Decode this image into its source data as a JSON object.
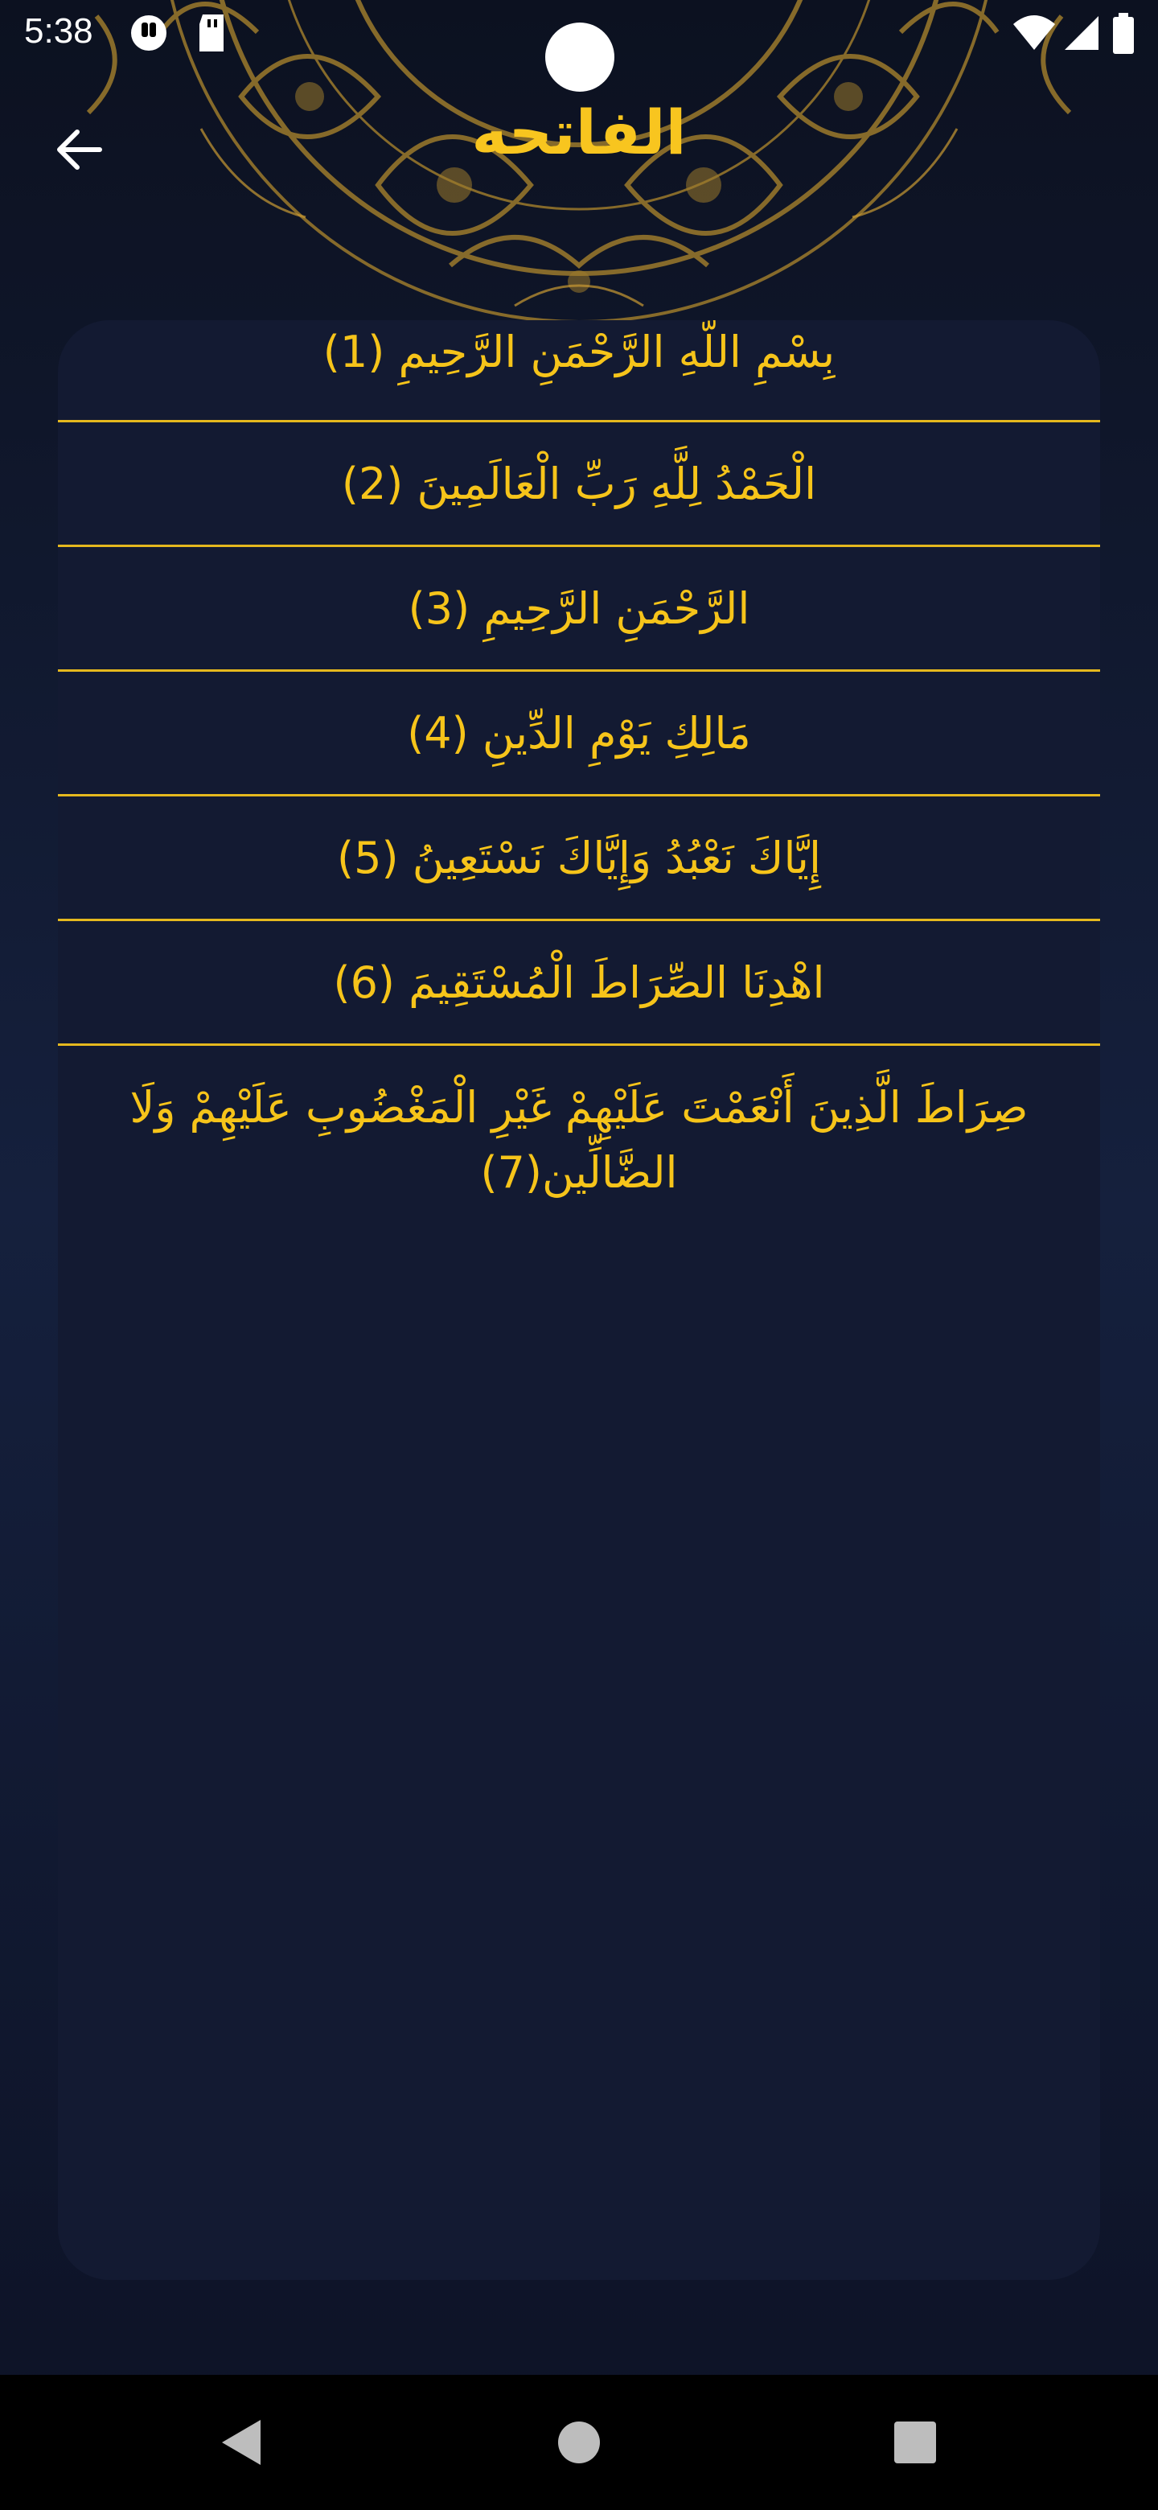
{
  "status_bar": {
    "time": "5:38",
    "icons": [
      "notification-icon",
      "sd-card-icon",
      "wifi-icon",
      "signal-icon",
      "battery-icon"
    ]
  },
  "app_bar": {
    "title": "الفاتحه",
    "back_icon": "arrow-left-icon"
  },
  "ayahs": [
    {
      "text": "بِسْمِ اللَّهِ الرَّحْمَنِ الرَّحِيمِ  (1)"
    },
    {
      "text": "الْحَمْدُ لِلَّهِ رَبِّ الْعَالَمِينَ (2)"
    },
    {
      "text": "الرَّحْمَنِ الرَّحِيمِ (3)"
    },
    {
      "text": "مَالِكِ يَوْمِ الدِّينِ (4)"
    },
    {
      "text": "إِيَّاكَ نَعْبُدُ وَإِيَّاكَ نَسْتَعِينُ (5)"
    },
    {
      "text": "اهْدِنَا الصِّرَاطَ الْمُسْتَقِيمَ (6)"
    },
    {
      "text": "صِرَاطَ الَّذِينَ أَنْعَمْتَ عَلَيْهِمْ غَيْرِ الْمَغْضُوبِ عَلَيْهِمْ وَلَا الضَّالِّين(7)"
    }
  ],
  "nav_bar": {
    "icons": [
      "back-triangle-icon",
      "home-circle-icon",
      "recents-square-icon"
    ]
  },
  "colors": {
    "accent": "#f6c41a",
    "background_top": "#0c1120",
    "background_mid": "#15203d",
    "card": "#131a32",
    "divider": "#e5b81e",
    "mandala": "#9c7a2c"
  }
}
